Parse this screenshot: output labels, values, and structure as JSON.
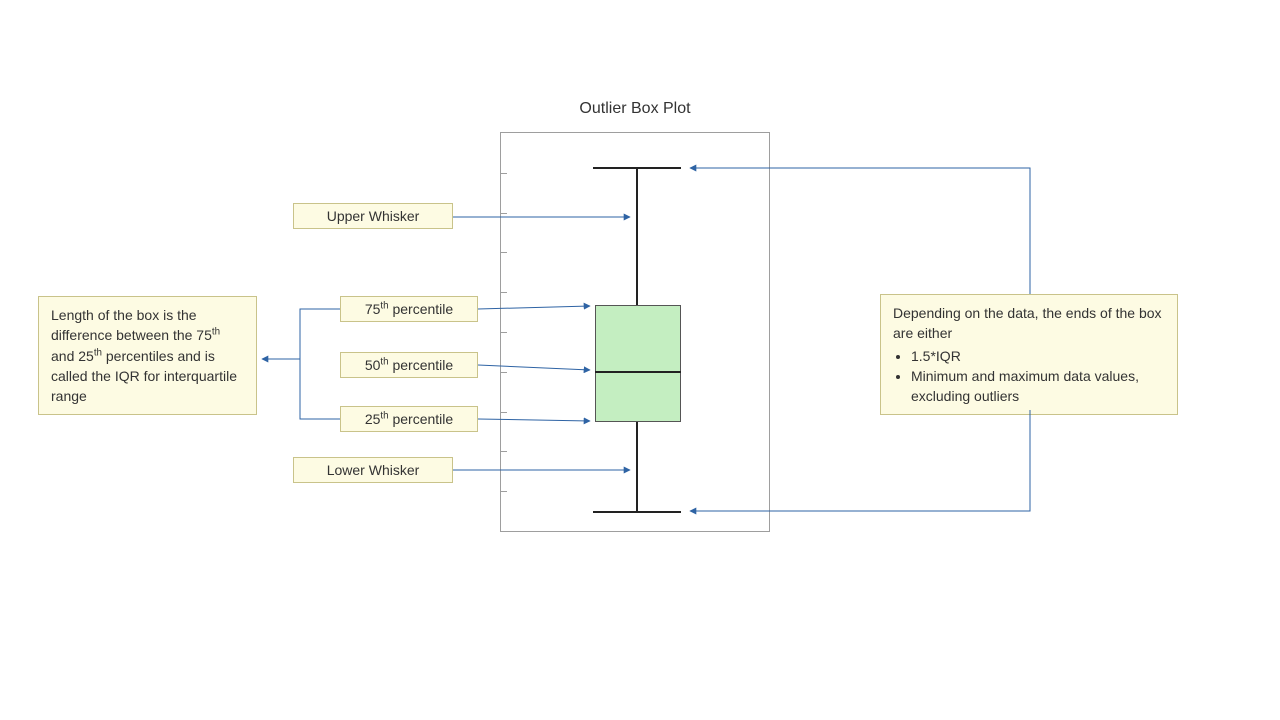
{
  "title": "Outlier Box Plot",
  "labels": {
    "upper_whisker": "Upper Whisker",
    "p75_pre": "75",
    "p75_sup": "th",
    "p75_post": " percentile",
    "p50_pre": "50",
    "p50_sup": "th",
    "p50_post": " percentile",
    "p25_pre": "25",
    "p25_sup": "th",
    "p25_post": " percentile",
    "lower_whisker": "Lower Whisker"
  },
  "iqr_note": {
    "seg1": "Length of the box is the difference between the 75",
    "sup1": "th",
    "seg2": " and 25",
    "sup2": "th",
    "seg3": " percentiles and is called the IQR for interquartile range"
  },
  "ends_note": {
    "intro": "Depending on the data, the ends of the box are either",
    "bullet1": "1.5*IQR",
    "bullet2": "Minimum and maximum data values, excluding outliers"
  },
  "colors": {
    "arrow": "#2e63a4",
    "box_fill": "#c4eec1",
    "callout_fill": "#fdfbe3",
    "callout_border": "#c9c38a"
  }
}
